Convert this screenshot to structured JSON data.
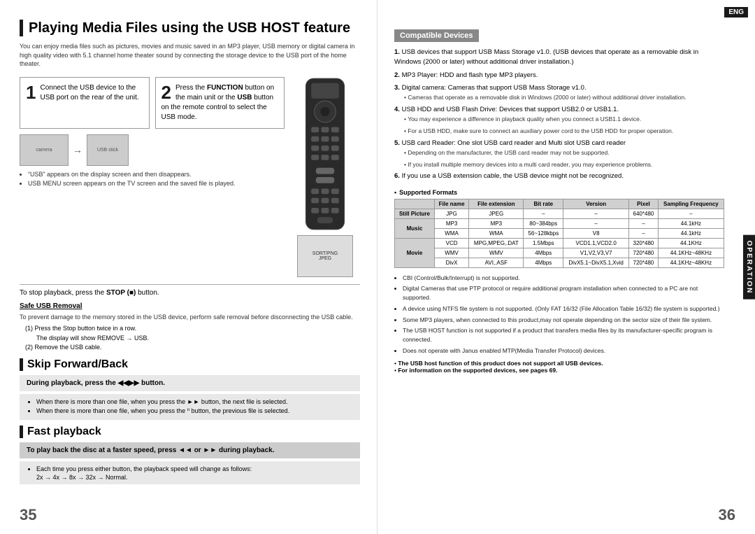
{
  "left_page": {
    "title": "Playing Media Files using the USB HOST feature",
    "intro": "You can enjoy media files such as pictures, movies and music saved in an MP3 player, USB memory or digital camera in high quality video with 5.1 channel home theater sound by connecting the storage device to the USB port of the home theater.",
    "step1": {
      "number": "1",
      "text": "Connect the USB device to the USB port on the rear of the unit."
    },
    "step2": {
      "number": "2",
      "text_parts": [
        "Press the ",
        "FUNCTION",
        " button on the main unit or the ",
        "USB",
        " button on the remote control to select the USB mode."
      ]
    },
    "bullet_notes": [
      "“USB” appears on the display screen and then disappears.",
      "USB MENU screen appears on the TV screen and the saved file is played."
    ],
    "stop_section": "To stop playback, press the STOP (■) button.",
    "safe_removal": {
      "title": "Safe USB Removal",
      "desc": "To prevent damage to the memory stored in the USB device, perform safe removal before disconnecting the USB cable.",
      "steps": [
        "Press the Stop button twice in a row.",
        "The display will show REMOVE → USB.",
        "Remove the USB cable."
      ]
    },
    "skip_section": {
      "title": "Skip Forward/Back",
      "highlight": "During playback, press the ᑊᑊ►► button.",
      "bullets": [
        "When there is more than one file, when you press the ►► button, the next file is selected.",
        "When there is more than one file, when you press the ᑊᑊ button, the previous file is selected."
      ]
    },
    "fast_playback": {
      "title": "Fast playback",
      "highlight": "To play back the disc at a faster speed, press ◄◄ or ►► during playback.",
      "sub_note": "Each time you press either button, the playback speed will change as follows:",
      "speeds": "2x → 4x → 8x → 32x → Normal."
    },
    "page_number": "35"
  },
  "right_page": {
    "eng_label": "ENG",
    "operation_label": "OPERATION",
    "compatible_devices_title": "Compatible Devices",
    "numbered_items": [
      {
        "number": "1",
        "text": "USB devices that support USB Mass Storage v1.0. (USB devices that operate as a removable disk in Windows (2000 or later) without additional driver installation.)"
      },
      {
        "number": "2",
        "text": "MP3 Player: HDD and flash type MP3 players."
      },
      {
        "number": "3",
        "text": "Digital camera: Cameras that support USB Mass Storage v1.0.",
        "subnotes": [
          "Cameras that operate as a removable disk in Windows (2000 or later) without additional driver installation."
        ]
      },
      {
        "number": "4",
        "text": "USB HDD and USB Flash Drive: Devices that support USB2.0 or USB1.1.",
        "subnotes": [
          "You may experience a difference in playback quality when you connect a USB1.1 device.",
          "For a USB HDD, make sure to connect an auxiliary power cord to the USB HDD for proper operation."
        ]
      },
      {
        "number": "5",
        "text": "USB card Reader: One slot USB card reader and Multi slot USB card reader",
        "subnotes": [
          "Depending on the manufacturer, the USB card reader may not be supported.",
          "If you install multiple memory devices into a multi card reader, you may experience problems."
        ]
      },
      {
        "number": "6",
        "text": "If you use a USB extension cable, the USB device might not be recognized."
      }
    ],
    "supported_formats": {
      "title": "Supported Formats",
      "columns": [
        "",
        "File name",
        "File extension",
        "Bit rate",
        "Version",
        "Pixel",
        "Sampling Frequency"
      ],
      "rows": [
        {
          "category": "Still Picture",
          "items": [
            [
              "JPG",
              "JPEG",
              "–",
              "–",
              "640*480",
              "–"
            ]
          ]
        },
        {
          "category": "Music",
          "items": [
            [
              "MP3",
              "MP3",
              "80~384bps",
              "–",
              "–",
              "44.1kHz"
            ],
            [
              "WMA",
              "WMA",
              "56~128kbps",
              "V8",
              "–",
              "44.1kHz"
            ]
          ]
        },
        {
          "category": "Movie",
          "items": [
            [
              "VCD",
              "MPG,MPEG,.DAT",
              "1.5Mbps",
              "VCD1.1,VCD2.0",
              "320*480",
              "44.1KHz"
            ],
            [
              "WMV",
              "WMV",
              "4Mbps",
              "V1,V2,V3,V7",
              "720*480",
              "44.1KHz~48KHz"
            ],
            [
              "DivX",
              "AVI,.ASF",
              "4Mbps",
              "DivX5.1~DivX5.1,Xvid",
              "720*480",
              "44.1KHz~48KHz"
            ]
          ]
        }
      ]
    },
    "notes": [
      "CBI (Control/Bulk/Interrupt) is not supported.",
      "Digital Cameras that use PTP protocol or require additional program installation when connected to a PC are not supported.",
      "A device using NTFS file system is not supported. (Only FAT 16/32 (File Allocation Table 16/32) file system is supported.)",
      "Some MP3 players, when connected to this product,may not operate depending on the sector size of their file system.",
      "The USB HOST function is not supported if a product that transfers media files by its manufacturer-specific program is connected.",
      "Does not operate with Janus enabled MTP(Media Transfer Protocol) devices."
    ],
    "bold_notes": [
      "The USB host function of this product does not support all USB devices.",
      "For information on the supported devices, see pages 69."
    ],
    "page_number": "36"
  }
}
